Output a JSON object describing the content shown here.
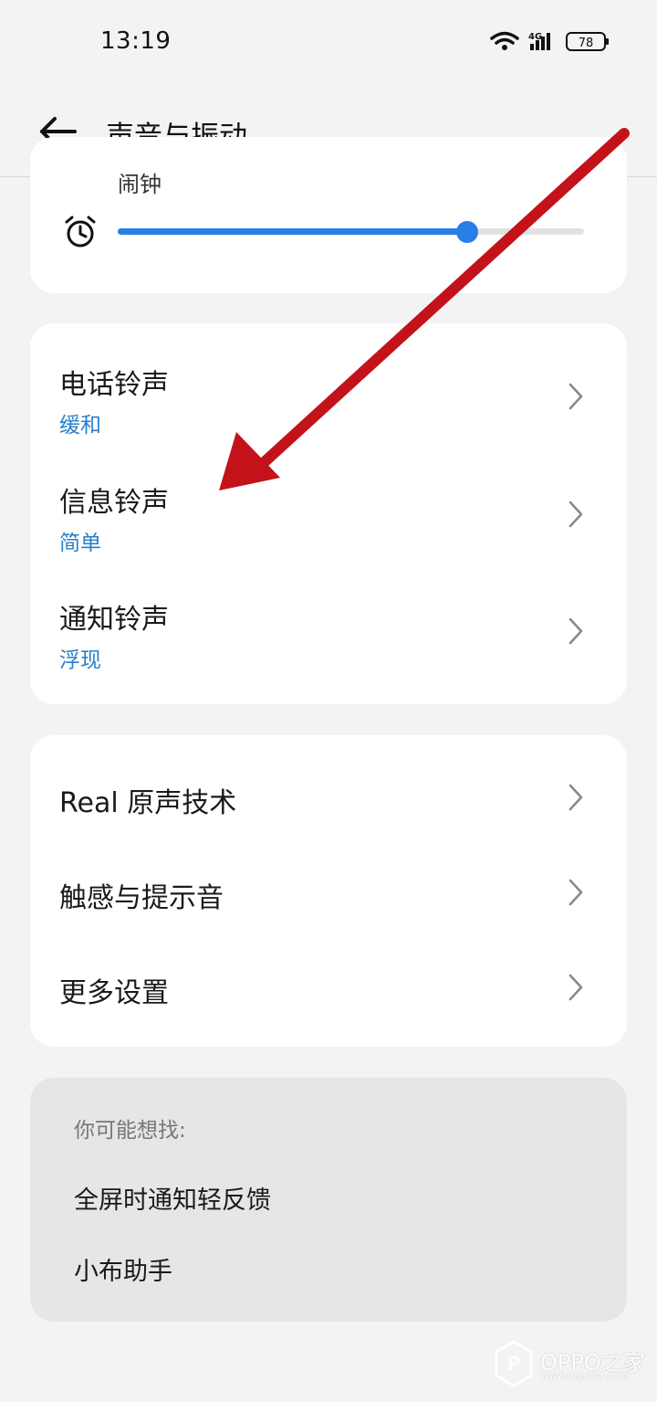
{
  "status_bar": {
    "time": "13:19",
    "network": "4G",
    "battery": "78"
  },
  "header": {
    "back_icon": "arrow-left-icon",
    "title": "声音与振动"
  },
  "alarm_card": {
    "label": "闹钟",
    "icon": "alarm-clock-icon",
    "volume_fraction": 0.75
  },
  "ringtones": [
    {
      "title": "电话铃声",
      "value": "缓和"
    },
    {
      "title": "信息铃声",
      "value": "简单"
    },
    {
      "title": "通知铃声",
      "value": "浮现"
    }
  ],
  "more_settings": [
    {
      "title": "Real 原声技术"
    },
    {
      "title": "触感与提示音"
    },
    {
      "title": "更多设置"
    }
  ],
  "suggestions": {
    "header": "你可能想找:",
    "items": [
      "全屏时通知轻反馈",
      "小布助手"
    ]
  },
  "annotation": {
    "arrow_color": "#c4121a"
  },
  "watermark": {
    "brand": "OPPO之家",
    "url": "www.oppojia.com"
  },
  "colors": {
    "accent": "#2a7fe6",
    "subtitle": "#2a7fc9"
  }
}
